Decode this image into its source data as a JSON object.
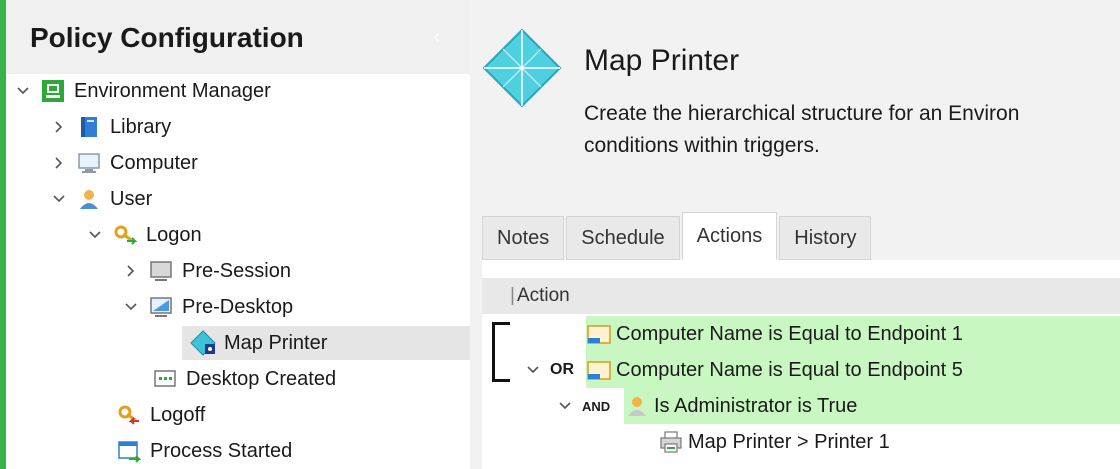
{
  "left": {
    "title": "Policy Configuration",
    "collapse_glyph": "‹",
    "tree": [
      {
        "label": "Environment Manager",
        "icon": "environment-manager-icon",
        "expanded": true
      },
      {
        "label": "Library",
        "icon": "library-book-icon",
        "expanded": false
      },
      {
        "label": "Computer",
        "icon": "computer-monitor-icon",
        "expanded": false
      },
      {
        "label": "User",
        "icon": "user-icon",
        "expanded": true
      },
      {
        "label": "Logon",
        "icon": "logon-key-icon",
        "expanded": true
      },
      {
        "label": "Pre-Session",
        "icon": "pre-session-icon",
        "expanded": false
      },
      {
        "label": "Pre-Desktop",
        "icon": "pre-desktop-icon",
        "expanded": true
      },
      {
        "label": "Map Printer",
        "icon": "map-printer-icon",
        "selected": true
      },
      {
        "label": "Desktop Created",
        "icon": "desktop-created-icon"
      },
      {
        "label": "Logoff",
        "icon": "logoff-key-icon"
      },
      {
        "label": "Process Started",
        "icon": "process-started-icon"
      }
    ]
  },
  "right": {
    "title": "Map Printer",
    "description_line1": "Create the hierarchical structure for an Environ",
    "description_line2": "conditions within triggers.",
    "tabs": [
      {
        "label": "Notes",
        "active": false
      },
      {
        "label": "Schedule",
        "active": false
      },
      {
        "label": "Actions",
        "active": true
      },
      {
        "label": "History",
        "active": false
      }
    ],
    "column_header": "Action",
    "rows": [
      {
        "operator": "",
        "text": "Computer Name is Equal to Endpoint 1",
        "icon": "condition-folder-icon",
        "highlight": true
      },
      {
        "operator": "OR",
        "text": "Computer Name is Equal to Endpoint 5",
        "icon": "condition-folder-icon",
        "highlight": true
      },
      {
        "operator": "AND",
        "text": "Is Administrator is True",
        "icon": "user-icon",
        "highlight": true
      },
      {
        "operator": "",
        "text": "Map Printer > Printer 1",
        "icon": "printer-icon",
        "highlight": false
      }
    ]
  },
  "colors": {
    "accent_green": "#37b34a",
    "row_highlight": "#c9f7c2",
    "icon_cyan": "#4fd0e0"
  }
}
